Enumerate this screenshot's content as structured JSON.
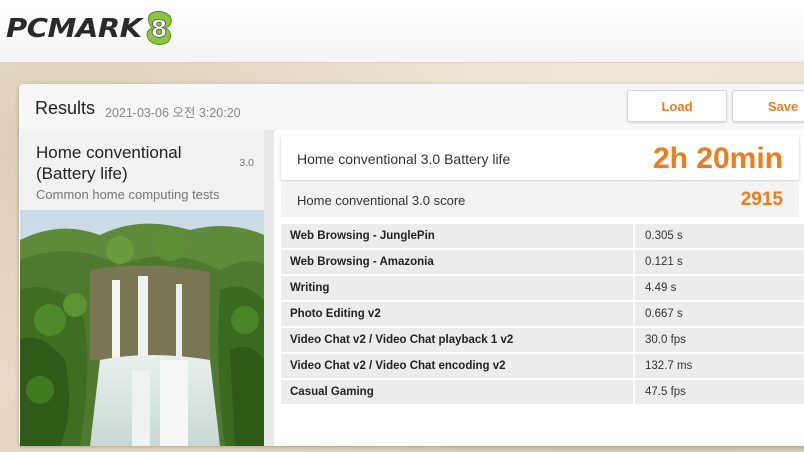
{
  "app": {
    "logo_text": "PCMARK",
    "logo_mark": "8"
  },
  "results": {
    "title": "Results",
    "date": "2021-03-06 오전 3:20:20",
    "load_label": "Load",
    "save_label": "Save"
  },
  "test": {
    "name": "Home conventional (Battery life)",
    "version": "3.0",
    "description": "Common home computing tests"
  },
  "scores": {
    "battery_label": "Home conventional 3.0 Battery life",
    "battery_value": "2h 20min",
    "score_label": "Home conventional 3.0 score",
    "score_value": "2915"
  },
  "rows": [
    {
      "name": "Web Browsing - JunglePin",
      "value": "0.305 s"
    },
    {
      "name": "Web Browsing - Amazonia",
      "value": "0.121 s"
    },
    {
      "name": "Writing",
      "value": "4.49 s"
    },
    {
      "name": "Photo Editing v2",
      "value": "0.667 s"
    },
    {
      "name": "Video Chat v2 / Video Chat playback 1 v2",
      "value": "30.0 fps"
    },
    {
      "name": "Video Chat v2 / Video Chat encoding v2",
      "value": "132.7 ms"
    },
    {
      "name": "Casual Gaming",
      "value": "47.5 fps"
    }
  ],
  "colors": {
    "accent": "#f07c1c",
    "logo_green": "#8cc63f"
  }
}
